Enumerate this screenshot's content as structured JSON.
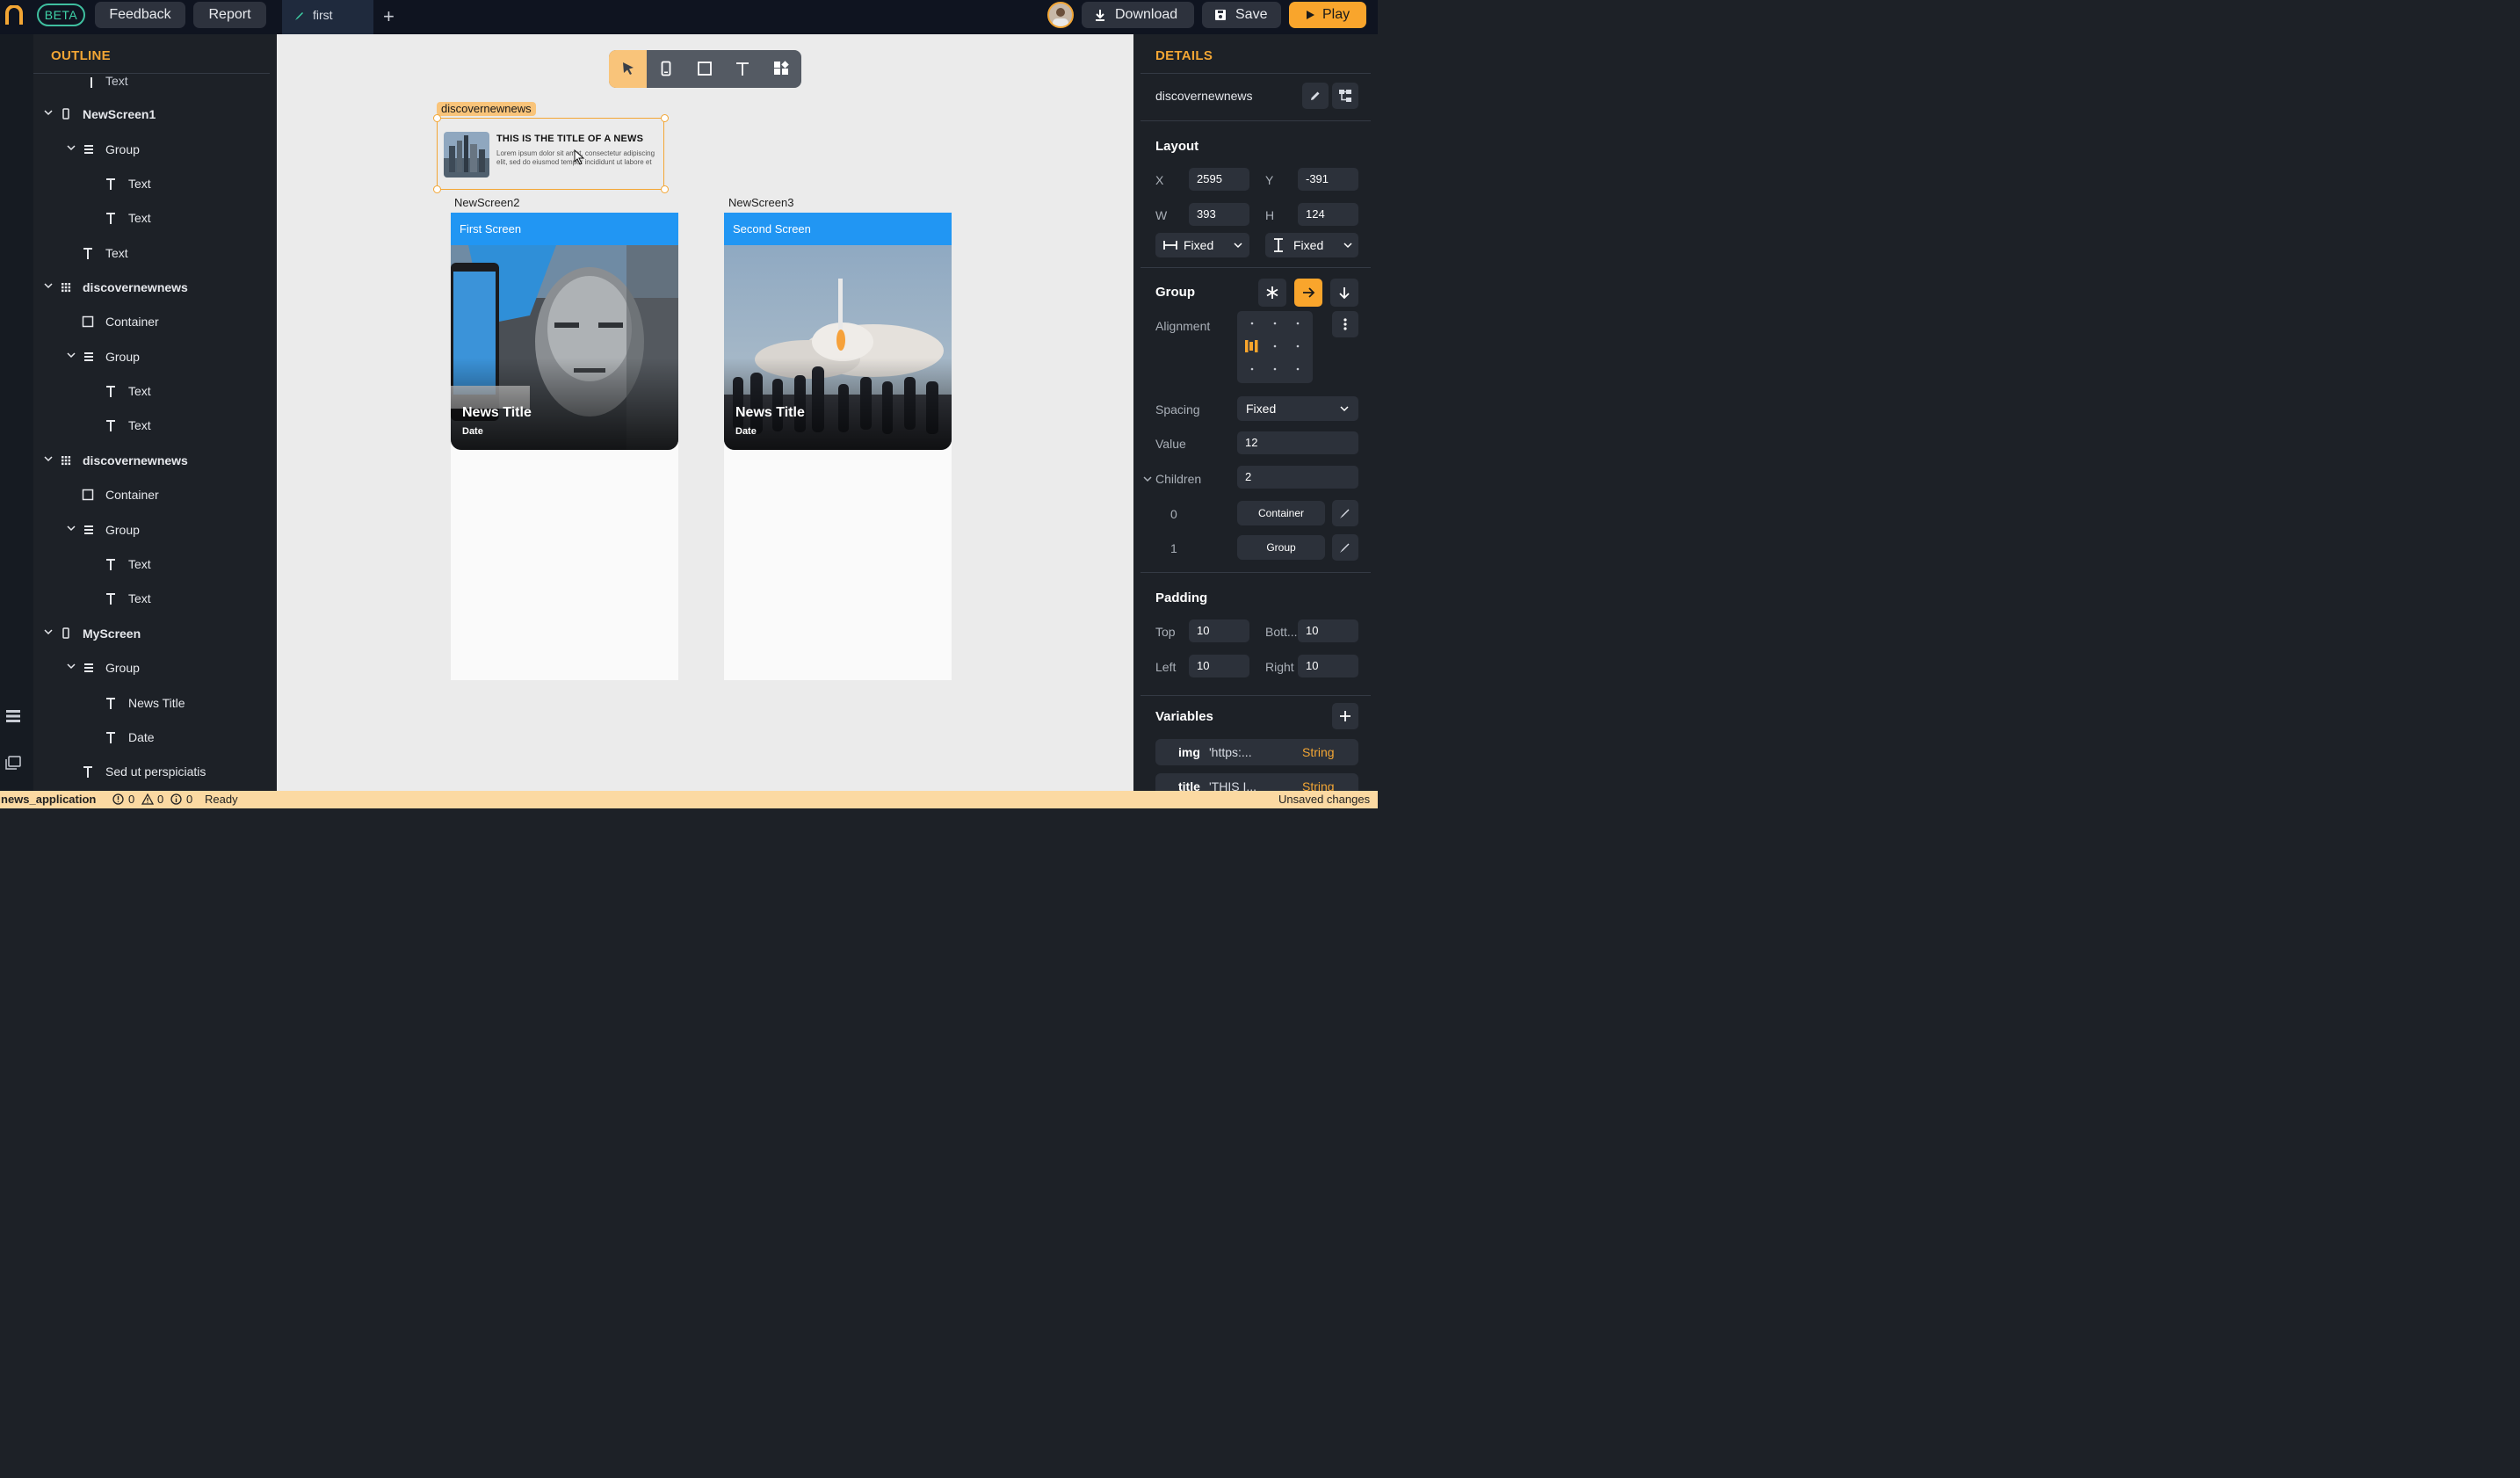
{
  "topbar": {
    "beta": "BETA",
    "feedback": "Feedback",
    "report": "Report",
    "tab": "first",
    "download": "Download",
    "save": "Save",
    "play": "Play"
  },
  "outline": {
    "title": "OUTLINE",
    "rows": [
      {
        "label": "Text",
        "icon": "text-icon"
      },
      {
        "label": "NewScreen1",
        "icon": "phone-icon"
      },
      {
        "label": "Group",
        "icon": "group-icon"
      },
      {
        "label": "Text",
        "icon": "text-icon"
      },
      {
        "label": "Text",
        "icon": "text-icon"
      },
      {
        "label": "Text",
        "icon": "text-icon"
      },
      {
        "label": "discovernewnews",
        "icon": "component-icon"
      },
      {
        "label": "Container",
        "icon": "container-icon"
      },
      {
        "label": "Group",
        "icon": "group-icon"
      },
      {
        "label": "Text",
        "icon": "text-icon"
      },
      {
        "label": "Text",
        "icon": "text-icon"
      },
      {
        "label": "discovernewnews",
        "icon": "component-icon"
      },
      {
        "label": "Container",
        "icon": "container-icon"
      },
      {
        "label": "Group",
        "icon": "group-icon"
      },
      {
        "label": "Text",
        "icon": "text-icon"
      },
      {
        "label": "Text",
        "icon": "text-icon"
      },
      {
        "label": "MyScreen",
        "icon": "phone-icon"
      },
      {
        "label": "Group",
        "icon": "group-icon"
      },
      {
        "label": "News Title",
        "icon": "text-icon"
      },
      {
        "label": "Date",
        "icon": "text-icon"
      },
      {
        "label": "Sed ut perspiciatis",
        "icon": "text-icon"
      }
    ]
  },
  "canvas": {
    "selection_label": "discovernewnews",
    "card_title": "THIS IS THE TITLE OF A NEWS",
    "card_body": "Lorem ipsum dolor sit amet, consectetur adipiscing elit, sed do eiusmod tempor incididunt ut labore et",
    "screen2_label": "NewScreen2",
    "screen2_appbar": "First Screen",
    "screen3_label": "NewScreen3",
    "screen3_appbar": "Second Screen",
    "hero_title": "News Title",
    "hero_date": "Date"
  },
  "details": {
    "title": "DETAILS",
    "component_name": "discovernewnews",
    "layout": {
      "heading": "Layout",
      "x_label": "X",
      "x_value": "2595",
      "y_label": "Y",
      "y_value": "-391",
      "w_label": "W",
      "w_value": "393",
      "h_label": "H",
      "h_value": "124",
      "width_mode": "Fixed",
      "height_mode": "Fixed"
    },
    "group": {
      "heading": "Group",
      "alignment_label": "Alignment",
      "spacing_label": "Spacing",
      "spacing_mode": "Fixed",
      "value_label": "Value",
      "value": "12",
      "children_label": "Children",
      "children_count": "2",
      "children": [
        {
          "index": "0",
          "name": "Container"
        },
        {
          "index": "1",
          "name": "Group"
        }
      ]
    },
    "padding": {
      "heading": "Padding",
      "top_label": "Top",
      "top": "10",
      "bottom_label": "Bott...",
      "bottom": "10",
      "left_label": "Left",
      "left": "10",
      "right_label": "Right",
      "right": "10"
    },
    "variables": {
      "heading": "Variables",
      "items": [
        {
          "name": "img",
          "value": "'https:...",
          "type": "String"
        },
        {
          "name": "title",
          "value": "'THIS I...",
          "type": "String"
        }
      ]
    }
  },
  "status": {
    "project": "news_application",
    "errors": "0",
    "warnings": "0",
    "infos": "0",
    "state": "Ready",
    "changes": "Unsaved changes"
  },
  "colors": {
    "accent": "#f9a52c",
    "appbar": "#2196f3",
    "beta": "#3fbf9f"
  }
}
